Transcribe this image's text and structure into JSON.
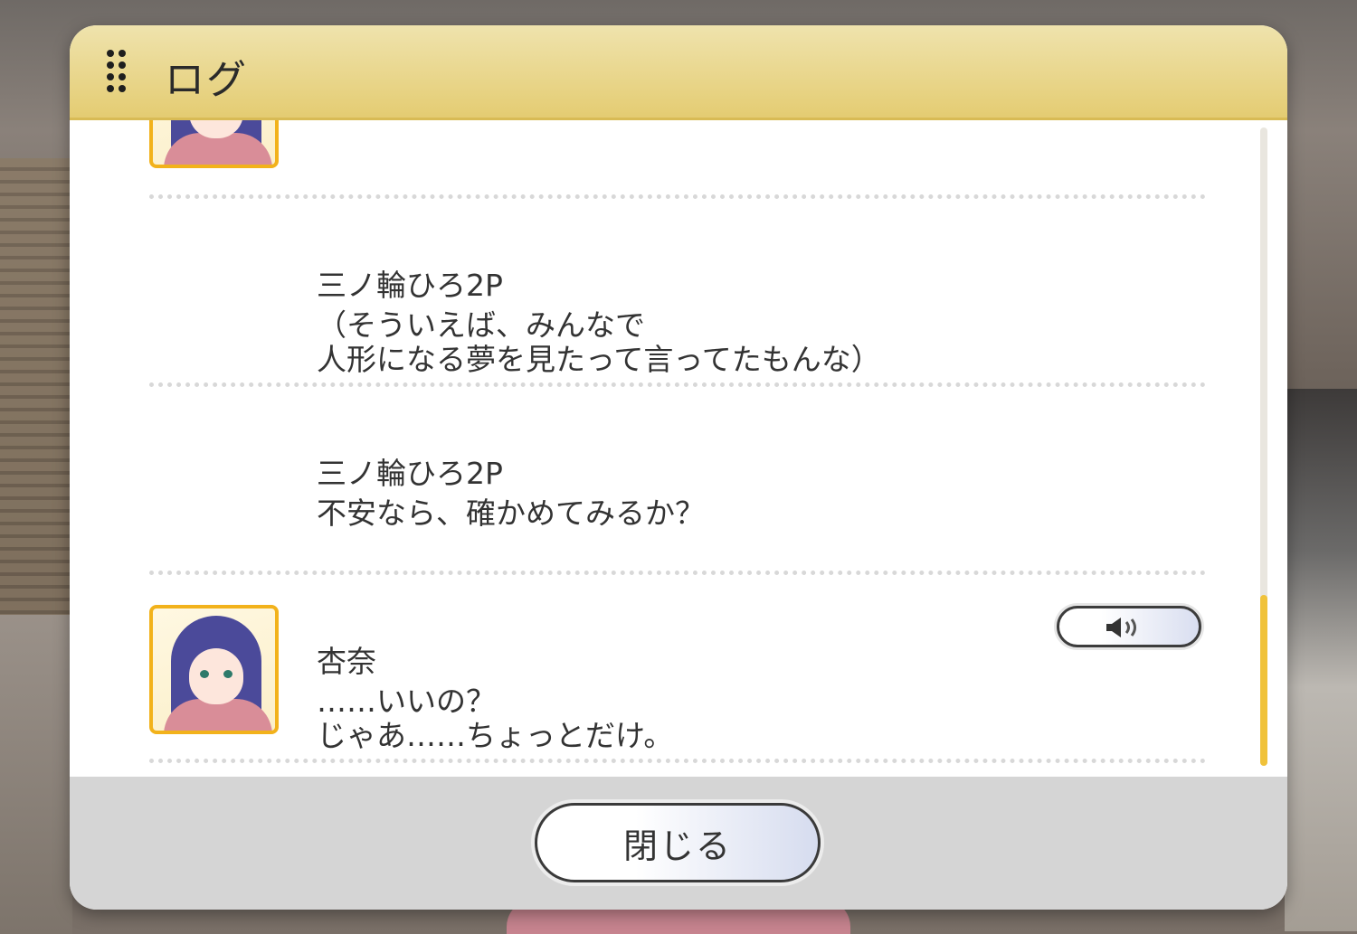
{
  "window": {
    "title": "ログ"
  },
  "log": {
    "partial_line": "…………………………",
    "entries": [
      {
        "speaker": "三ノ輪ひろ2P",
        "text": "（そういえば、みんなで\n人形になる夢を見たって言ってたもんな）",
        "has_portrait": false,
        "has_voice": false
      },
      {
        "speaker": "三ノ輪ひろ2P",
        "text": "不安なら、確かめてみるか？",
        "has_portrait": false,
        "has_voice": false
      },
      {
        "speaker": "杏奈",
        "text": "……いいの？\nじゃあ……ちょっとだけ。",
        "has_portrait": true,
        "has_voice": true
      }
    ]
  },
  "footer": {
    "close_label": "閉じる"
  },
  "colors": {
    "header": "#e4cc72",
    "accent": "#f2b21b",
    "scroll_thumb": "#f0c23a",
    "footer": "#d5d5d5"
  },
  "icons": {
    "voice": "speaker-icon",
    "grip": "grip-icon"
  }
}
